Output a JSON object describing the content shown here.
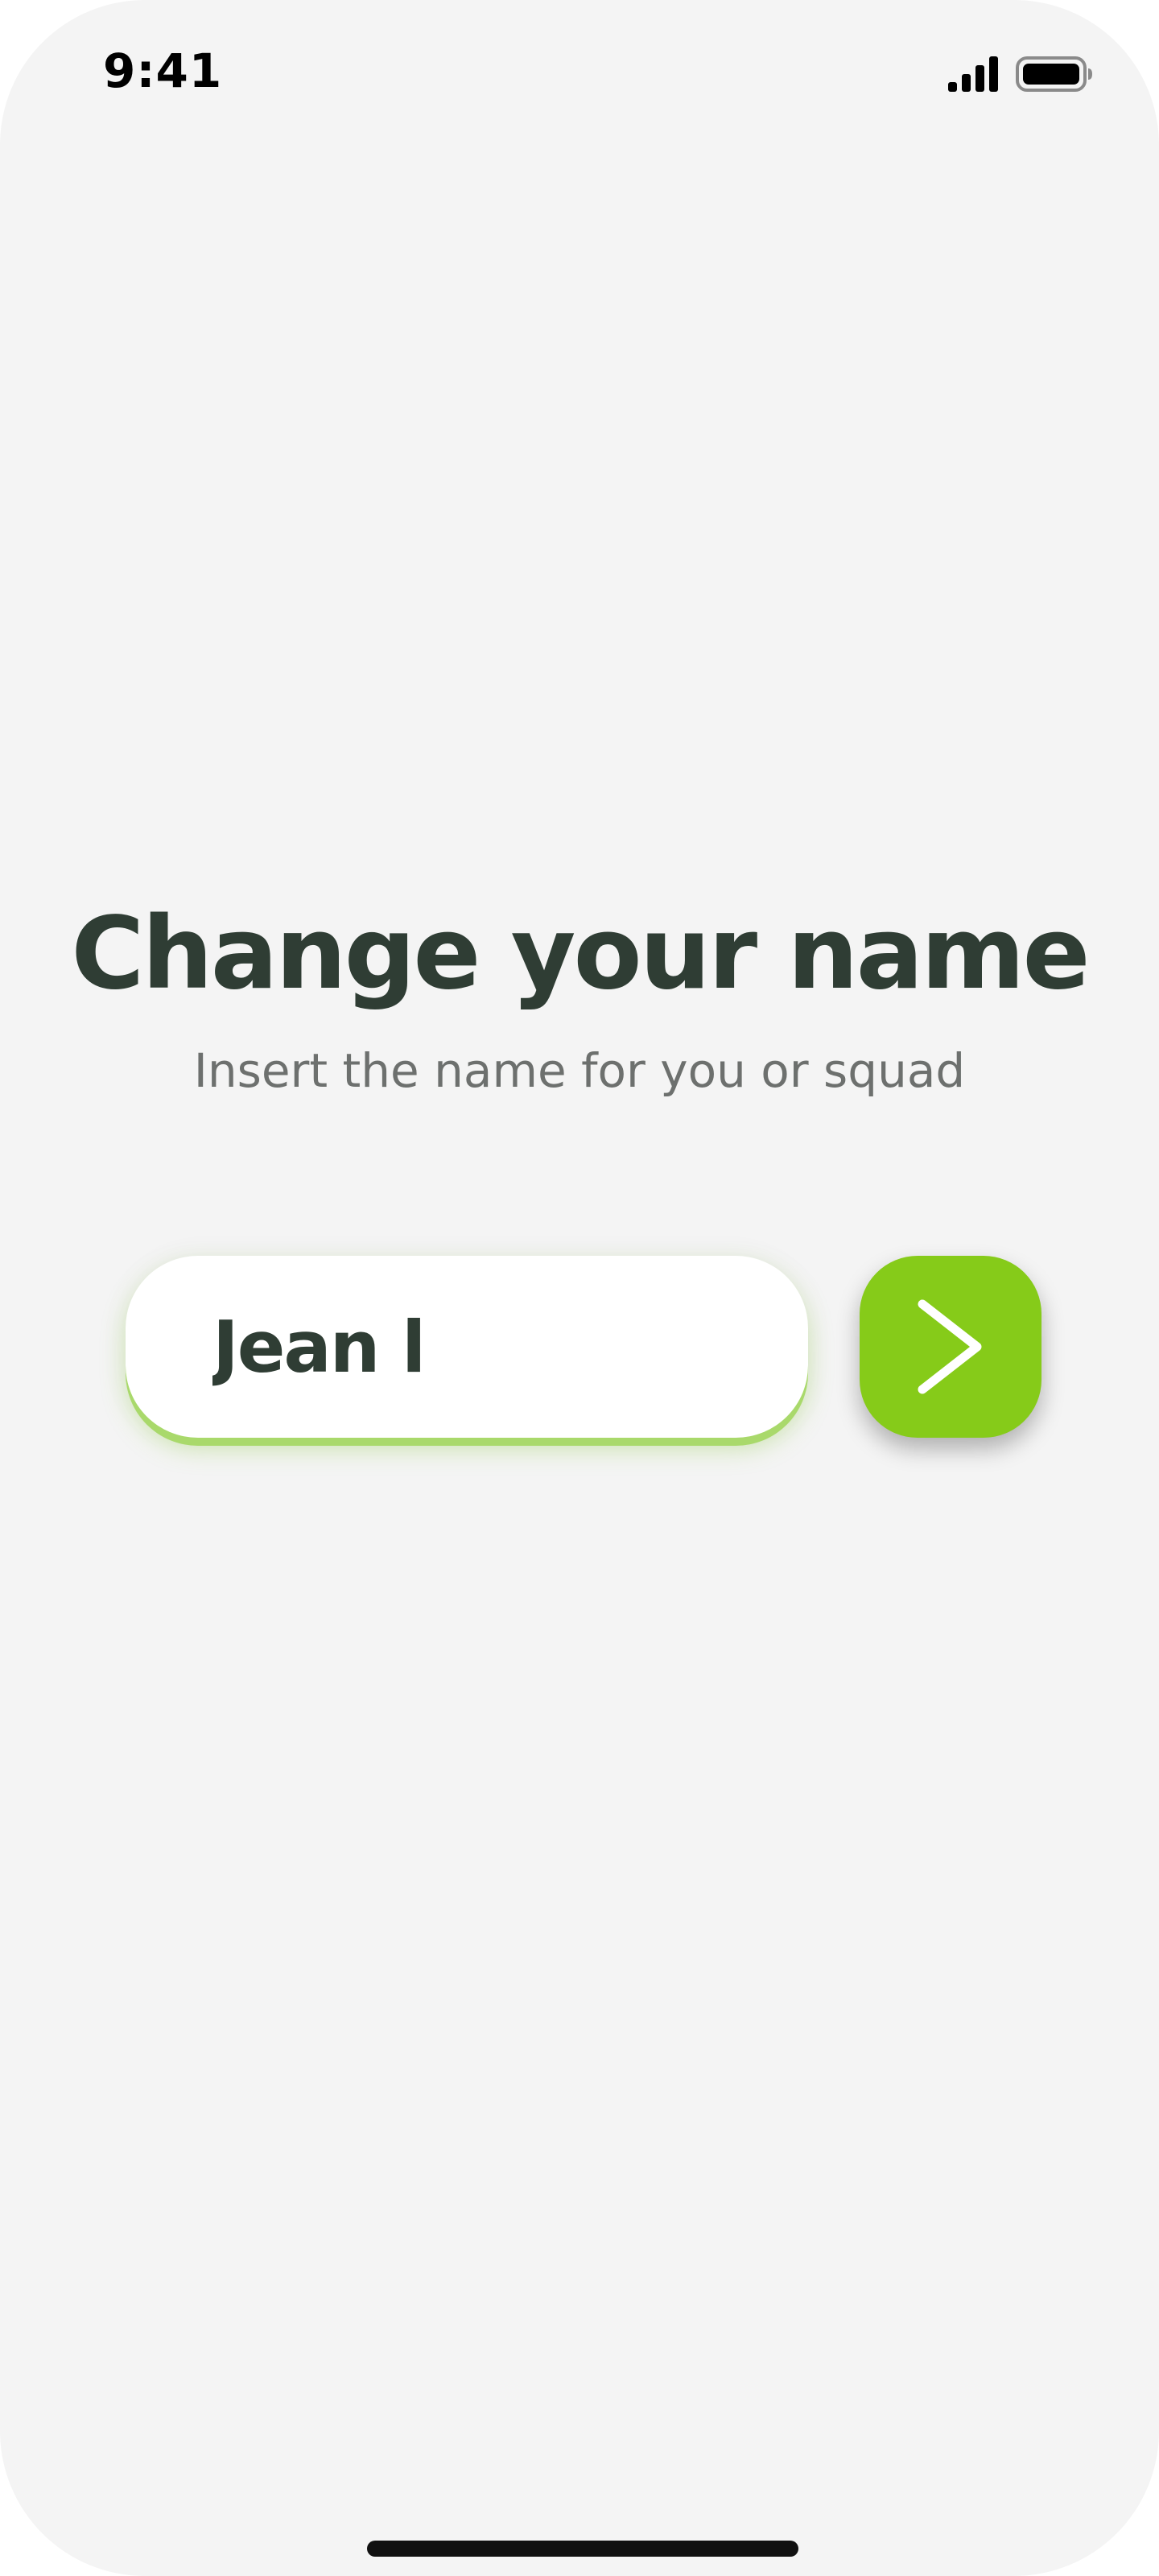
{
  "status_bar": {
    "time": "9:41",
    "signal_icon": "cellular-signal-icon",
    "battery_icon": "battery-full-icon"
  },
  "screen": {
    "title": "Change your name",
    "subtitle": "Insert the name for you or squad"
  },
  "name_input": {
    "value": "Jean l",
    "placeholder": ""
  },
  "next_button": {
    "icon": "chevron-right-icon"
  },
  "colors": {
    "background": "#f4f4f4",
    "title_text": "#2f3d34",
    "subtitle_text": "#6d706e",
    "accent": "#86cb19",
    "input_glow": "#a9d96b"
  }
}
